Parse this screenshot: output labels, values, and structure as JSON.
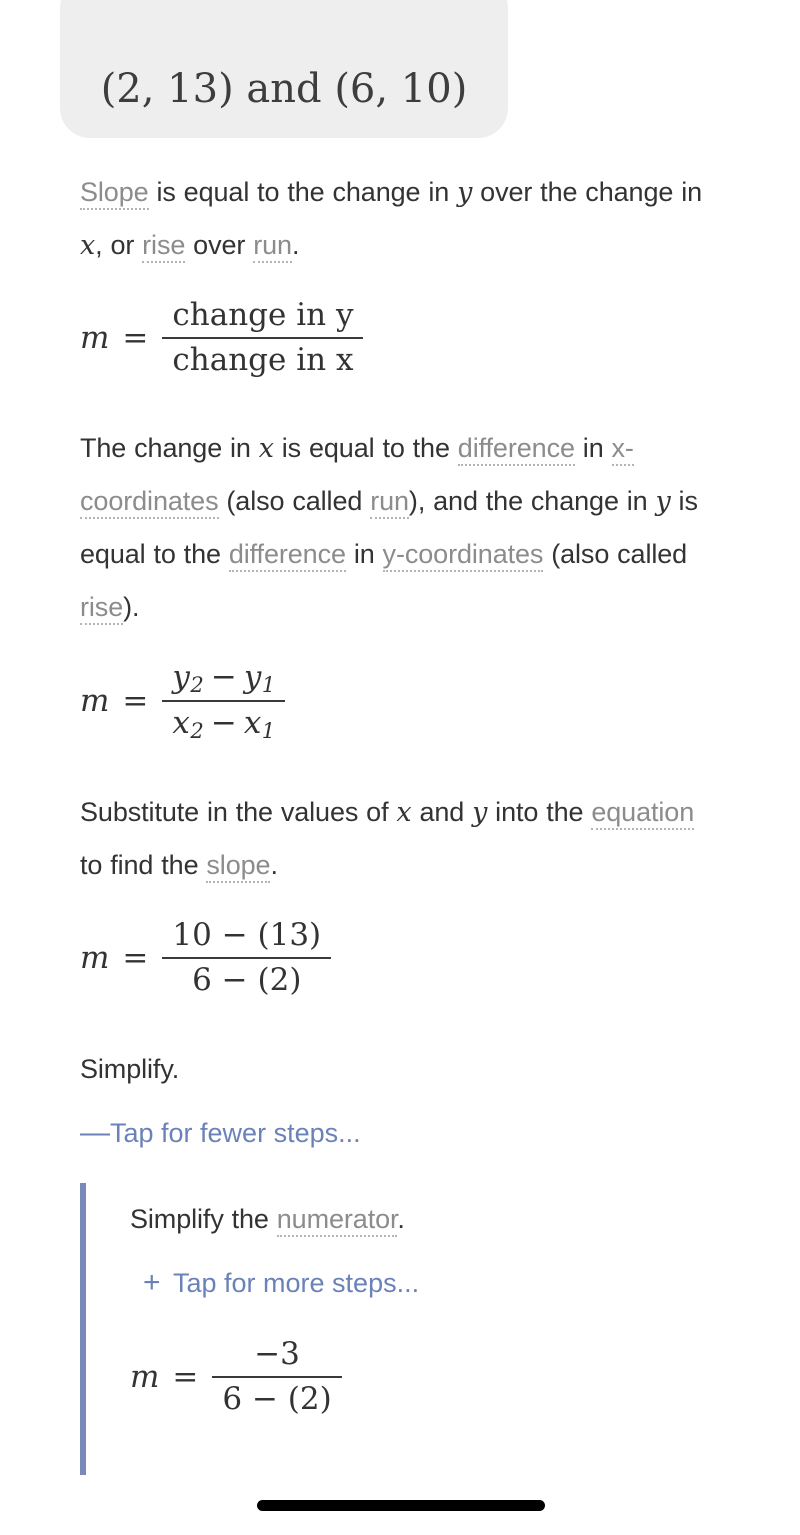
{
  "header": {
    "problem": "(2, 13) and (6, 10)"
  },
  "colors": {
    "pill_background": "#eeeeee",
    "body_text": "#333333",
    "glossary_term": "#8c8c8c",
    "link": "#6b82b8",
    "substep_border": "#7a8ab8",
    "home_indicator": "#000000"
  },
  "steps": {
    "intro": {
      "part1": "Slope",
      "part2": " is equal to the change in ",
      "var_y": "y",
      "part3": " over the change in ",
      "var_x": "x",
      "part4": ", or ",
      "term_rise": "rise",
      "part5": " over ",
      "term_run": "run",
      "part6": "."
    },
    "formula_words": {
      "m": "m",
      "equals": "=",
      "numerator": "change in y",
      "denominator": "change in x"
    },
    "explain": {
      "part1": "The change in ",
      "var_x": "x",
      "part2": " is equal to the ",
      "term_difference1": "difference",
      "part3": " in ",
      "term_xcoords": "x-coordinates",
      "part4": " (also called ",
      "term_run": "run",
      "part5": "), and the change in ",
      "var_y": "y",
      "part6": " is equal to the ",
      "term_difference2": "difference",
      "part7": " in ",
      "term_ycoords": "y-coordinates",
      "part8": " (also called ",
      "term_rise": "rise",
      "part9": ")."
    },
    "formula_subscripts": {
      "m": "m",
      "equals": "=",
      "num_y2": "y",
      "num_sub2": "2",
      "num_minus": "−",
      "num_y1": "y",
      "num_sub1": "1",
      "den_x2": "x",
      "den_sub2": "2",
      "den_minus": "−",
      "den_x1": "x",
      "den_sub1": "1"
    },
    "substitute": {
      "part1": "Substitute in the values of ",
      "var_x": "x",
      "part2": " and ",
      "var_y": "y",
      "part3": " into the ",
      "term_equation": "equation",
      "part4": " to find the ",
      "term_slope": "slope",
      "part5": "."
    },
    "formula_substituted": {
      "m": "m",
      "equals": "=",
      "numerator": "10 − (13)",
      "denominator": "6 − (2)"
    },
    "simplify": {
      "label": "Simplify.",
      "toggle_sign": "—",
      "toggle_label": "Tap for fewer steps..."
    },
    "substep": {
      "part1": "Simplify the ",
      "term_numerator": "numerator",
      "part2": ".",
      "toggle_sign": "+",
      "toggle_label": "Tap for more steps...",
      "formula": {
        "m": "m",
        "equals": "=",
        "numerator": "−3",
        "denominator": "6 − (2)"
      }
    }
  }
}
